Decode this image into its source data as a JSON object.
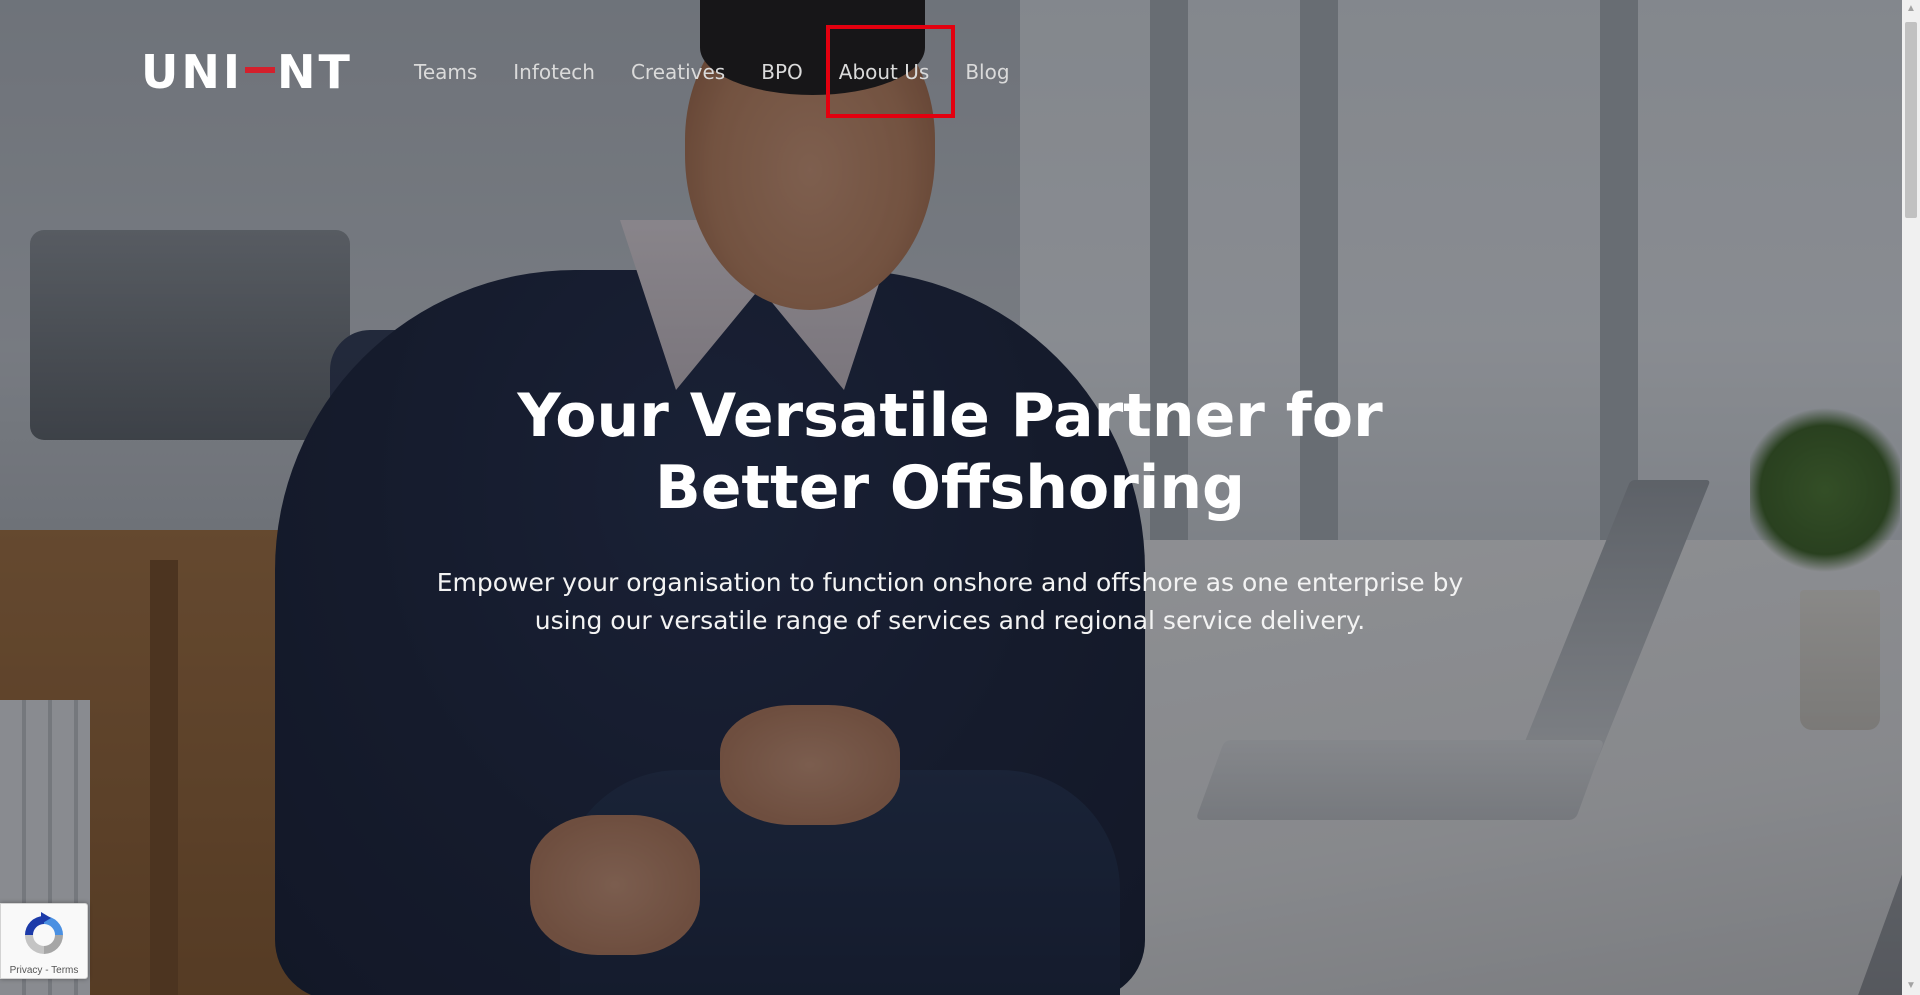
{
  "brand": {
    "logo_text": "UNIENT",
    "logo_parts": [
      "UNI",
      "NT"
    ],
    "accent_color": "#d4202c"
  },
  "nav": {
    "items": [
      {
        "label": "Teams"
      },
      {
        "label": "Infotech"
      },
      {
        "label": "Creatives"
      },
      {
        "label": "BPO"
      },
      {
        "label": "About Us"
      },
      {
        "label": "Blog"
      }
    ],
    "highlighted": "About Us",
    "highlight_color": "#e3000f"
  },
  "hero": {
    "title": "Your Versatile Partner for Better Offshoring",
    "subtitle": "Empower your organisation to function onshore and offshore as one enterprise by using our versatile range of services and regional service delivery."
  },
  "recaptcha": {
    "icon": "recaptcha-icon",
    "links": "Privacy - Terms"
  },
  "scrollbar": {
    "up_icon": "chevron-up-icon",
    "down_icon": "chevron-down-icon"
  }
}
